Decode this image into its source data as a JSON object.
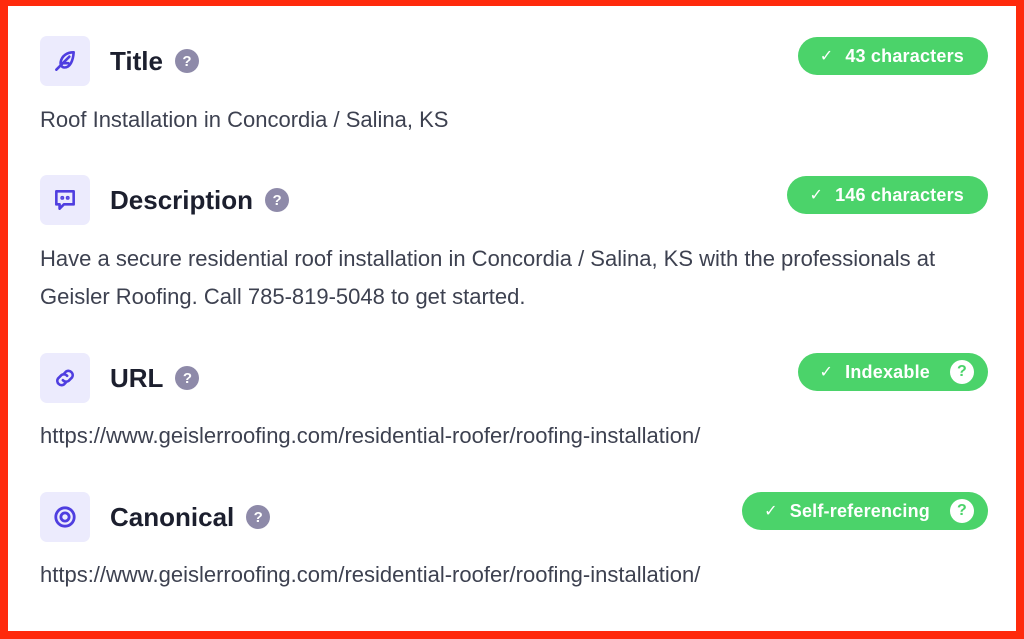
{
  "sections": [
    {
      "icon": "feather-icon",
      "label": "Title",
      "badge": {
        "check": "✓",
        "text": "43 characters",
        "has_help": false
      },
      "value": "Roof Installation in Concordia / Salina, KS"
    },
    {
      "icon": "message-square-icon",
      "label": "Description",
      "badge": {
        "check": "✓",
        "text": "146 characters",
        "has_help": false
      },
      "value": "Have a secure residential roof installation in Concordia / Salina, KS with the professionals at Geisler Roofing. Call 785-819-5048 to get started."
    },
    {
      "icon": "link-icon",
      "label": "URL",
      "badge": {
        "check": "✓",
        "text": "Indexable",
        "has_help": true
      },
      "value": "https://www.geislerroofing.com/residential-roofer/roofing-installation/"
    },
    {
      "icon": "target-icon",
      "label": "Canonical",
      "badge": {
        "check": "✓",
        "text": "Self-referencing",
        "has_help": true
      },
      "value": "https://www.geislerroofing.com/residential-roofer/roofing-installation/"
    }
  ],
  "help_glyph": "?",
  "colors": {
    "accent": "#4f3ee0",
    "icon_bg": "#ecebfd",
    "badge_green": "#4bd36a",
    "help_gray": "#8e8aa9",
    "border_red": "#ff2a0c"
  }
}
